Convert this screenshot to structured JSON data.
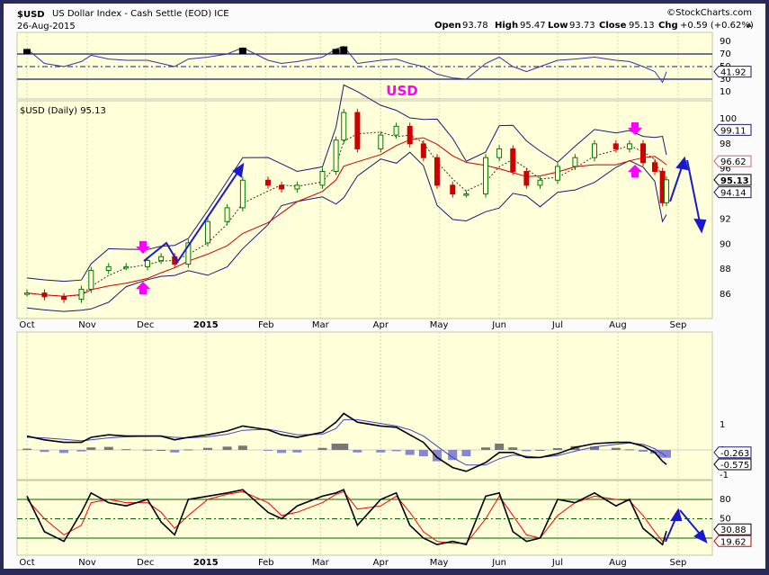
{
  "header": {
    "symbol": "$USD",
    "name": "US Dollar Index - Cash Settle (EOD) ICE",
    "date": "26-Aug-2015",
    "watermark": "©StockCharts.com",
    "open_label": "Open",
    "open": "93.78",
    "high_label": "High",
    "high": "95.47",
    "low_label": "Low",
    "low": "93.73",
    "close_label": "Close",
    "close": "95.13",
    "chg_label": "Chg",
    "chg": "+0.59 (+0.62%)",
    "chg_icon": "triangle-up-icon"
  },
  "annotation": {
    "text": "USD",
    "color": "#ff00ff"
  },
  "price_legend": "$USD (Daily) 95.13",
  "colors": {
    "panel": "#ffffd9",
    "up": "#007a00",
    "down": "#cc0000",
    "band": "#1a1a7a",
    "ma_long": "#cc0000",
    "rsi": "#3333aa",
    "macd": "#000000",
    "signal": "#4444cc",
    "stoch_d": "#ff0000",
    "arrow": "#1a1acc"
  },
  "chart_data": [
    {
      "type": "line",
      "panel": "rsi",
      "yticks": [
        "90",
        "70",
        "50",
        "30",
        "10"
      ],
      "ylim": [
        0,
        100
      ],
      "levels": [
        70,
        50,
        30
      ],
      "last_label": "41.92",
      "x": [
        "2014-10-01",
        "2014-10-10",
        "2014-10-20",
        "2014-10-29",
        "2014-11-03",
        "2014-11-12",
        "2014-11-21",
        "2014-12-02",
        "2014-12-09",
        "2014-12-16",
        "2014-12-23",
        "2015-01-02",
        "2015-01-12",
        "2015-01-20",
        "2015-02-02",
        "2015-02-09",
        "2015-02-17",
        "2015-03-02",
        "2015-03-09",
        "2015-03-13",
        "2015-03-20",
        "2015-04-01",
        "2015-04-09",
        "2015-04-16",
        "2015-04-23",
        "2015-04-30",
        "2015-05-08",
        "2015-05-15",
        "2015-05-25",
        "2015-06-01",
        "2015-06-08",
        "2015-06-15",
        "2015-06-22",
        "2015-07-01",
        "2015-07-10",
        "2015-07-20",
        "2015-07-31",
        "2015-08-07",
        "2015-08-14",
        "2015-08-20",
        "2015-08-24",
        "2015-08-26"
      ],
      "values": [
        78,
        55,
        50,
        58,
        68,
        62,
        60,
        60,
        55,
        50,
        62,
        65,
        70,
        80,
        60,
        55,
        58,
        65,
        78,
        82,
        55,
        60,
        62,
        55,
        50,
        38,
        32,
        30,
        55,
        65,
        50,
        42,
        50,
        60,
        62,
        65,
        60,
        58,
        50,
        42,
        25,
        41.92
      ]
    },
    {
      "type": "candlestick",
      "panel": "price",
      "yticks": [
        "100",
        "98",
        "96",
        "92",
        "90",
        "88",
        "86"
      ],
      "ylim": [
        84.5,
        101.5
      ],
      "xticks": [
        "Oct",
        "Nov",
        "Dec",
        "2015",
        "Feb",
        "Mar",
        "Apr",
        "May",
        "Jun",
        "Jul",
        "Aug",
        "Sep"
      ],
      "tags": {
        "upper_band": "99.11",
        "ma": "96.62",
        "close": "95.13",
        "lower_band": "94.14"
      },
      "close": [
        86.1,
        85.8,
        85.6,
        86.4,
        87.9,
        88.2,
        88.2,
        88.7,
        89.0,
        88.4,
        90.1,
        91.8,
        92.9,
        95.1,
        94.7,
        94.4,
        94.7,
        95.8,
        98.3,
        100.5,
        97.6,
        98.7,
        99.4,
        98.0,
        96.9,
        94.7,
        94.0,
        94.0,
        96.9,
        97.6,
        95.8,
        94.7,
        95.1,
        96.2,
        96.9,
        98.0,
        97.6,
        98.0,
        96.5,
        95.8,
        93.3,
        95.13
      ]
    },
    {
      "type": "line",
      "panel": "macd",
      "yticks": [
        "1",
        "0",
        "-1"
      ],
      "ylim": [
        -1.2,
        1.8
      ],
      "labels": [
        "-0.263",
        "-0.575"
      ],
      "macd": [
        0.55,
        0.4,
        0.3,
        0.3,
        0.5,
        0.6,
        0.55,
        0.55,
        0.55,
        0.4,
        0.5,
        0.6,
        0.75,
        0.95,
        0.8,
        0.6,
        0.5,
        0.7,
        1.1,
        1.45,
        1.1,
        0.95,
        0.9,
        0.6,
        0.3,
        -0.3,
        -0.7,
        -0.85,
        -0.5,
        -0.1,
        -0.1,
        -0.3,
        -0.3,
        -0.15,
        0.1,
        0.25,
        0.3,
        0.3,
        0.15,
        -0.1,
        -0.45,
        -0.575
      ],
      "signal": [
        0.5,
        0.48,
        0.42,
        0.36,
        0.4,
        0.48,
        0.52,
        0.54,
        0.55,
        0.5,
        0.48,
        0.52,
        0.62,
        0.78,
        0.82,
        0.72,
        0.6,
        0.62,
        0.85,
        1.2,
        1.2,
        1.05,
        0.95,
        0.8,
        0.55,
        0.15,
        -0.3,
        -0.6,
        -0.6,
        -0.35,
        -0.2,
        -0.25,
        -0.3,
        -0.22,
        -0.05,
        0.12,
        0.22,
        0.28,
        0.22,
        0.05,
        -0.15,
        -0.263
      ]
    },
    {
      "type": "line",
      "panel": "stochastic",
      "yticks": [
        "80",
        "50",
        "20"
      ],
      "ylim": [
        0,
        100
      ],
      "labels": [
        "30.88",
        "19.62"
      ],
      "k": [
        85,
        30,
        15,
        60,
        90,
        75,
        70,
        80,
        45,
        25,
        80,
        85,
        90,
        95,
        60,
        50,
        70,
        85,
        90,
        95,
        40,
        80,
        90,
        40,
        20,
        10,
        15,
        10,
        85,
        90,
        30,
        15,
        20,
        80,
        75,
        90,
        70,
        80,
        35,
        20,
        10,
        30.88
      ],
      "d": [
        80,
        50,
        25,
        40,
        75,
        80,
        75,
        75,
        60,
        35,
        55,
        80,
        88,
        92,
        75,
        55,
        60,
        75,
        88,
        92,
        65,
        70,
        85,
        60,
        30,
        15,
        12,
        12,
        50,
        85,
        55,
        25,
        20,
        55,
        75,
        85,
        80,
        78,
        55,
        30,
        15,
        19.62
      ]
    }
  ]
}
